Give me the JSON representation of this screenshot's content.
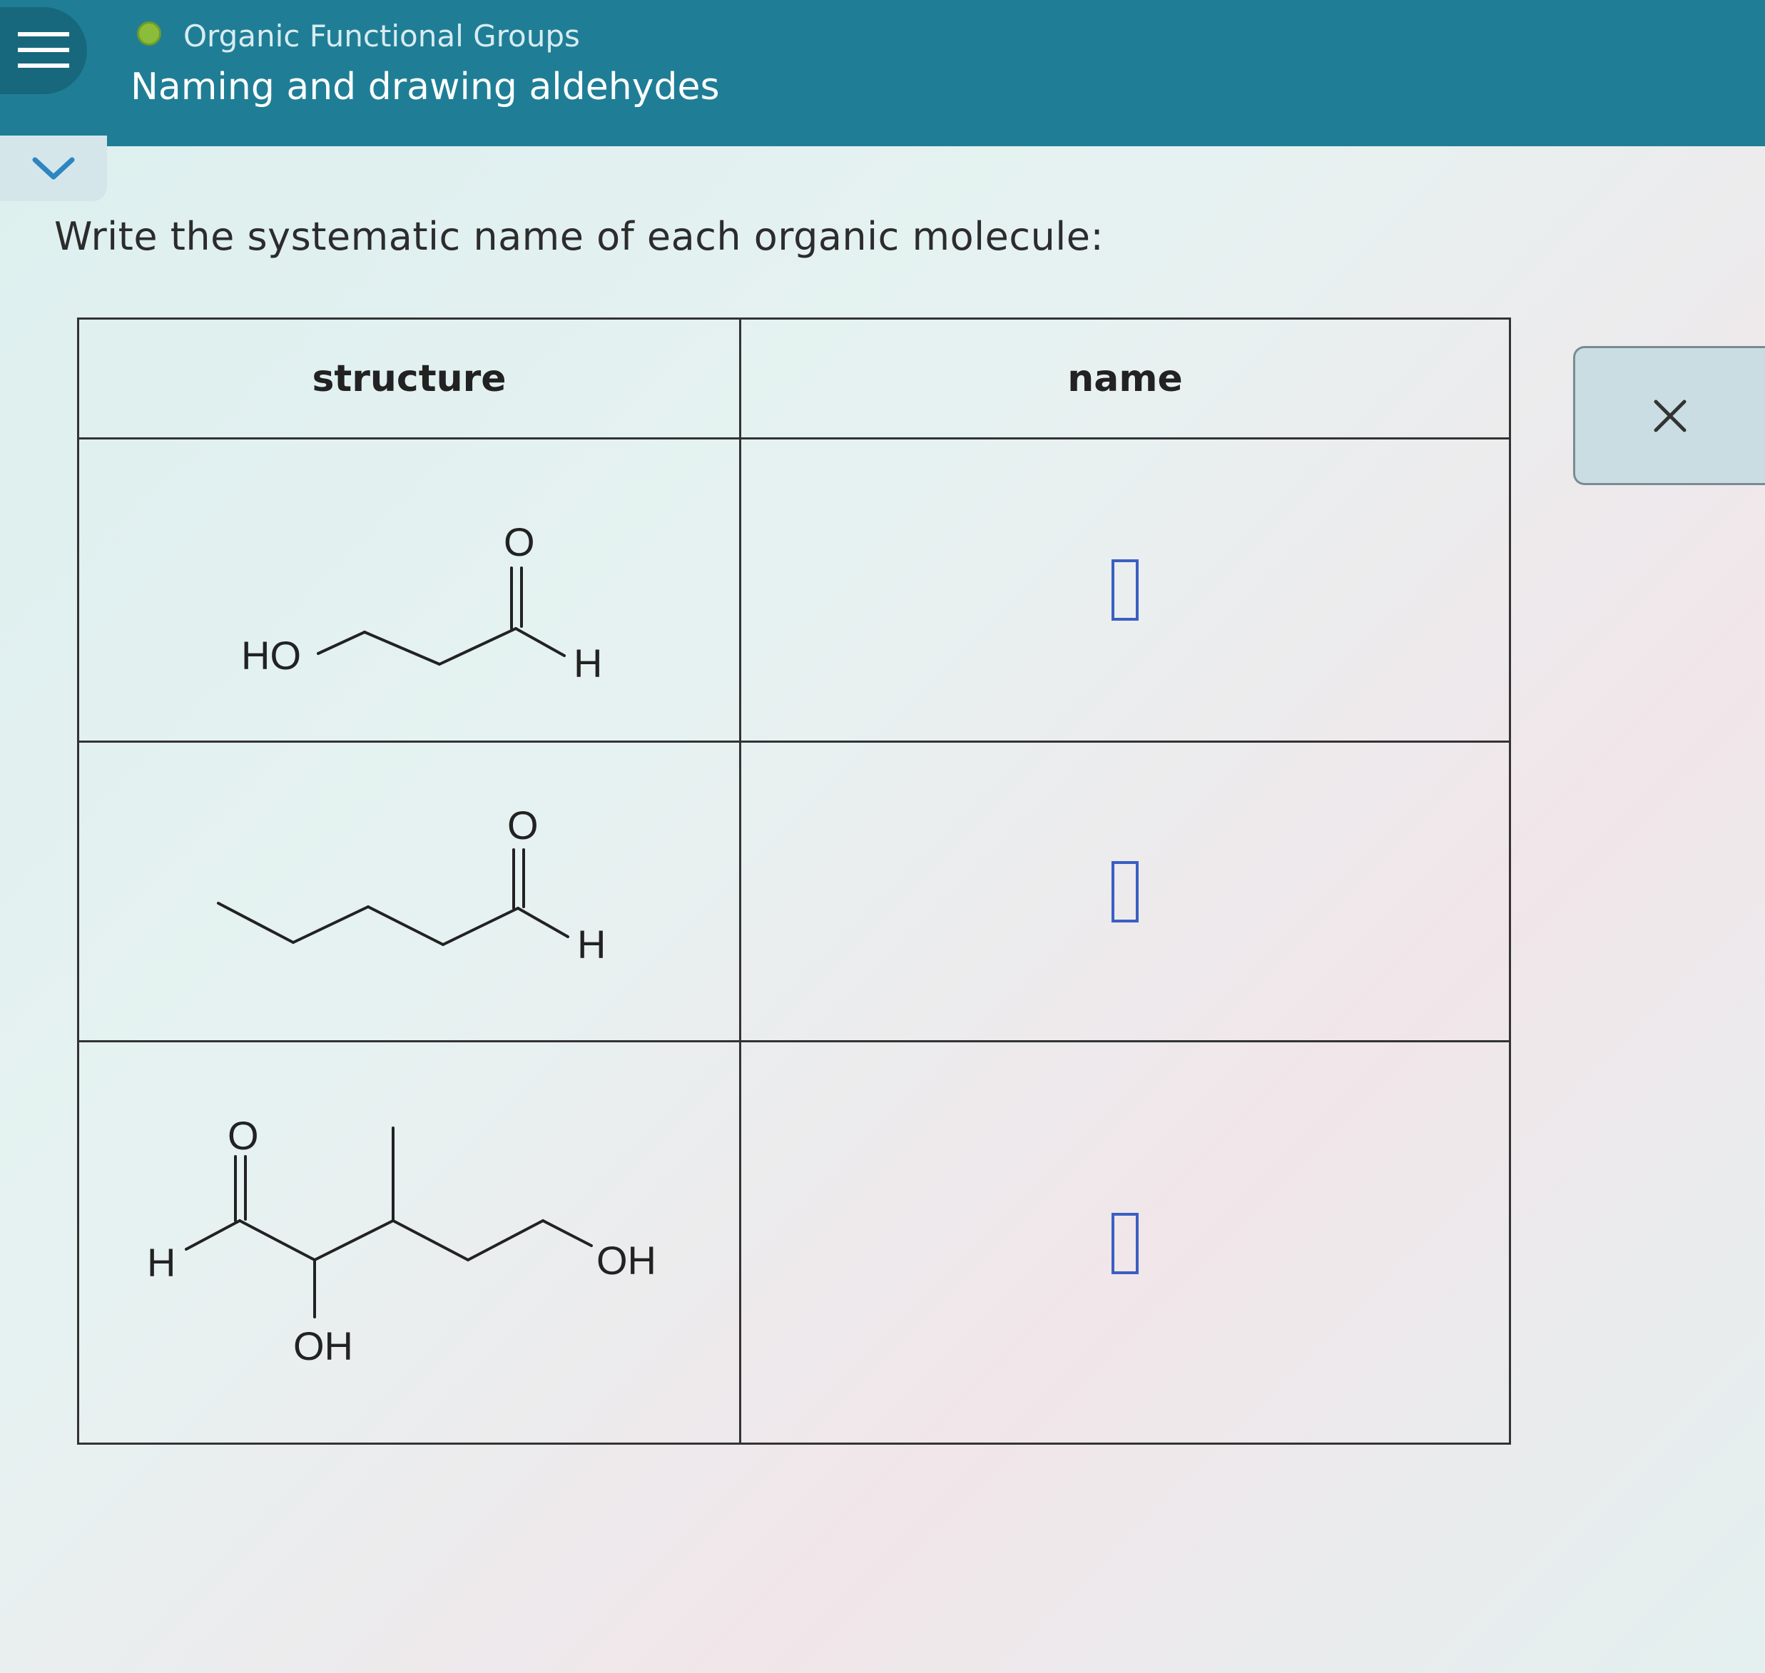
{
  "header": {
    "topic": "Organic Functional Groups",
    "lesson": "Naming and drawing aldehydes"
  },
  "prompt": "Write the systematic name of each organic molecule:",
  "table": {
    "headers": {
      "structure": "structure",
      "name": "name"
    },
    "rows": [
      {
        "labels": {
          "ho": "HO",
          "o": "O",
          "h": "H"
        }
      },
      {
        "labels": {
          "o": "O",
          "h": "H"
        }
      },
      {
        "labels": {
          "h": "H",
          "o": "O",
          "oh_bottom": "OH",
          "oh_right": "OH"
        }
      }
    ]
  },
  "icons": {
    "menu": "hamburger-menu-icon",
    "collapse": "chevron-down-icon",
    "close": "close-icon"
  },
  "colors": {
    "header_bg": "#1f7e96",
    "status_dot": "#8bbd3a",
    "answer_box_border": "#3a5fc2",
    "chevron": "#2e86c1"
  }
}
